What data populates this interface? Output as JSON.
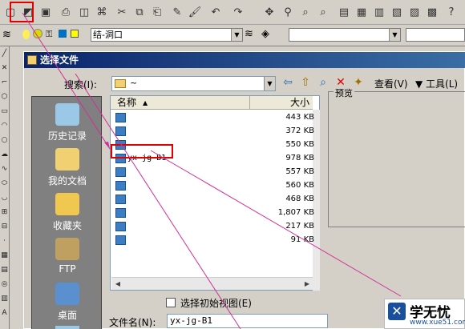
{
  "dialog": {
    "title": "选择文件",
    "search_label": "搜索(I):",
    "search_value": "~",
    "view_label": "查看(V)",
    "tools_label": "▼ 工具(L)",
    "preview_label": "预览",
    "name_col": "名称",
    "size_col": "大小",
    "initial_view_label": "选择初始视图(E)",
    "filename_label": "文件名(N):",
    "filename_value": "yx-jg-B1"
  },
  "places": [
    {
      "label": "历史记录",
      "icon": "history-icon"
    },
    {
      "label": "我的文档",
      "icon": "my-documents-icon"
    },
    {
      "label": "收藏夹",
      "icon": "favorites-icon"
    },
    {
      "label": "FTP",
      "icon": "ftp-icon"
    },
    {
      "label": "桌面",
      "icon": "desktop-icon"
    }
  ],
  "files": [
    {
      "name": "",
      "size": "443 KB"
    },
    {
      "name": "",
      "size": "372 KB"
    },
    {
      "name": "",
      "size": "550 KB"
    },
    {
      "name": "yx-jg-B1",
      "size": "978 KB"
    },
    {
      "name": "",
      "size": "557 KB"
    },
    {
      "name": "",
      "size": "560 KB"
    },
    {
      "name": "",
      "size": "468 KB"
    },
    {
      "name": "",
      "size": "1,807 KB"
    },
    {
      "name": "",
      "size": "217 KB"
    },
    {
      "name": "",
      "size": "91 KB"
    }
  ],
  "toolbar2": {
    "layer_value": "结-洞口"
  },
  "watermark": {
    "text": "学无忧",
    "url": "www.xue51.com"
  },
  "colors": {
    "title_start": "#0a246a",
    "title_end": "#3a6ea5",
    "highlight": "#e00000",
    "arrow": "#d0309a"
  }
}
